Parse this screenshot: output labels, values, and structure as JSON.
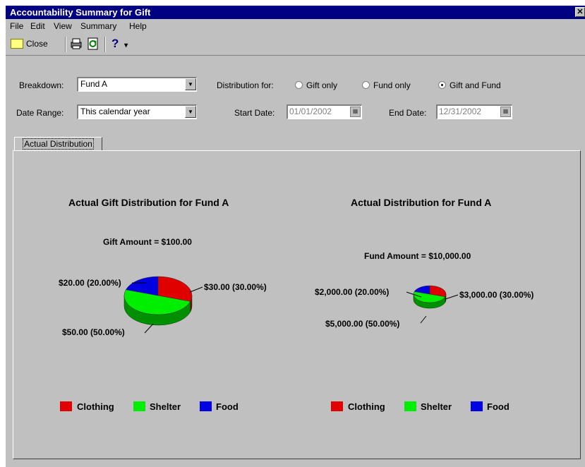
{
  "window": {
    "title": "Accountability Summary for Gift",
    "close_glyph": "✕"
  },
  "menu": {
    "items": [
      "File",
      "Edit",
      "View",
      "Summary",
      "Help"
    ]
  },
  "toolbar": {
    "close_label": "Close",
    "help_glyph": "?",
    "dropdown_glyph": "▾"
  },
  "filters": {
    "breakdown_label": "Breakdown:",
    "breakdown_value": "Fund A",
    "date_range_label": "Date Range:",
    "date_range_value": "This calendar year",
    "distribution_label": "Distribution for:",
    "distribution_options": [
      "Gift only",
      "Fund only",
      "Gift and Fund"
    ],
    "distribution_selected": "Gift and Fund",
    "start_date_label": "Start Date:",
    "start_date_value": "01/01/2002",
    "end_date_label": "End Date:",
    "end_date_value": "12/31/2002"
  },
  "tabs": [
    {
      "label": "Actual Distribution",
      "active": true
    }
  ],
  "colors": {
    "clothing": "#e00000",
    "shelter": "#00ee00",
    "food": "#0000e0"
  },
  "chart_data": [
    {
      "type": "pie",
      "title": "Actual Gift Distribution for Fund A",
      "subtitle": "Gift Amount = $100.00",
      "categories": [
        "Clothing",
        "Shelter",
        "Food"
      ],
      "values": [
        30.0,
        50.0,
        20.0
      ],
      "labels": [
        "$30.00 (30.00%)",
        "$50.00 (50.00%)",
        "$20.00 (20.00%)"
      ],
      "legend": [
        "Clothing",
        "Shelter",
        "Food"
      ],
      "legend_position": "bottom"
    },
    {
      "type": "pie",
      "title": "Actual Distribution for Fund A",
      "subtitle": "Fund Amount = $10,000.00",
      "categories": [
        "Clothing",
        "Shelter",
        "Food"
      ],
      "values": [
        3000.0,
        5000.0,
        2000.0
      ],
      "labels": [
        "$3,000.00 (30.00%)",
        "$5,000.00 (50.00%)",
        "$2,000.00 (20.00%)"
      ],
      "legend": [
        "Clothing",
        "Shelter",
        "Food"
      ],
      "legend_position": "bottom"
    }
  ]
}
